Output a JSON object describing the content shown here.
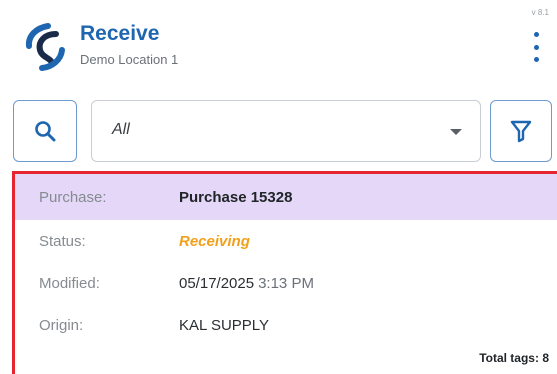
{
  "header": {
    "title": "Receive",
    "subtitle": "Demo Location 1",
    "version": "v 8.1",
    "brand_color": "#1e66b0"
  },
  "filter": {
    "search_icon": "search-icon",
    "selected": "All",
    "filter_icon": "filter-icon"
  },
  "purchase": {
    "label": "Purchase:",
    "value": "Purchase 15328",
    "highlight_color": "#e4d7f7",
    "selected_border_color": "#e6262e"
  },
  "status": {
    "label": "Status:",
    "value": "Receiving",
    "color": "#f2a01b"
  },
  "modified": {
    "label": "Modified:",
    "date": "05/17/2025",
    "time": "3:13 PM"
  },
  "origin": {
    "label": "Origin:",
    "value": "KAL SUPPLY"
  },
  "total_tags": "Total tags: 8"
}
